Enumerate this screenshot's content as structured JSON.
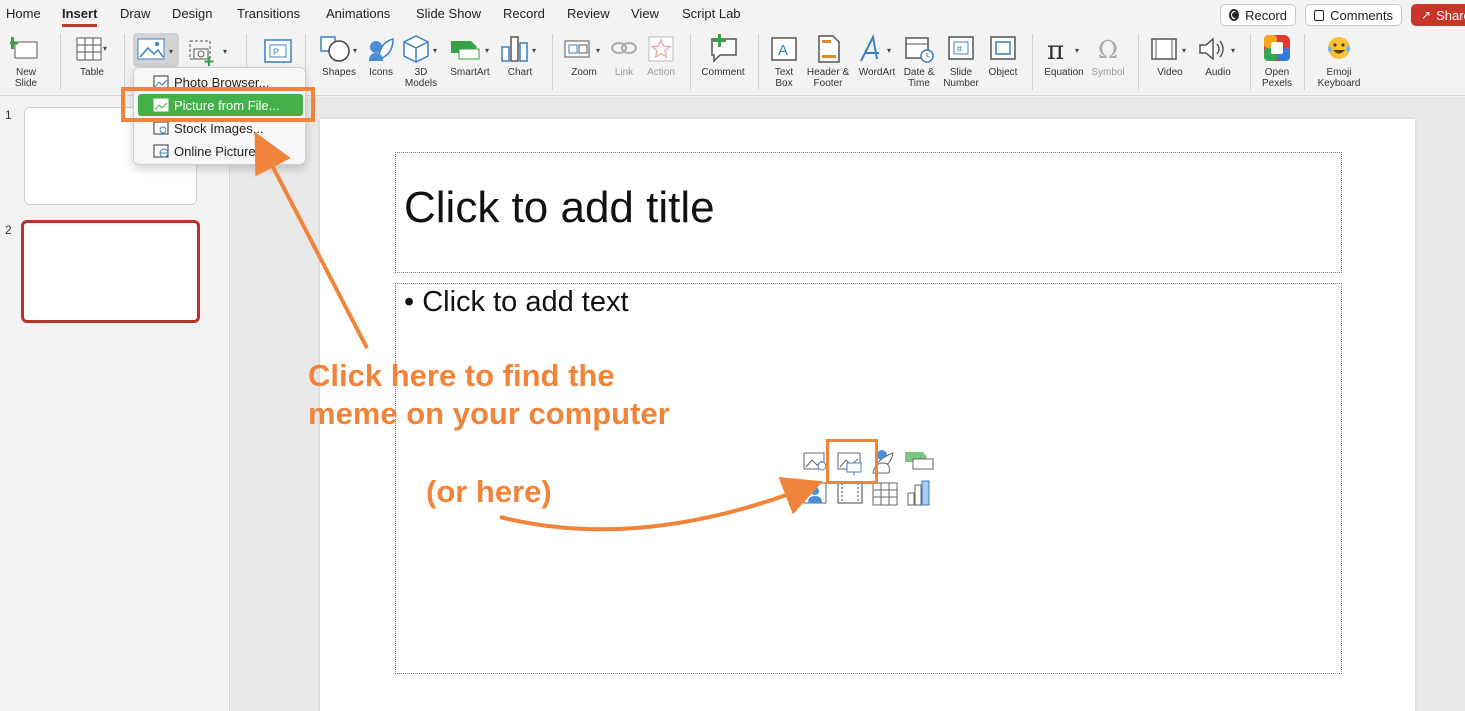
{
  "tabs": [
    "Home",
    "Insert",
    "Draw",
    "Design",
    "Transitions",
    "Animations",
    "Slide Show",
    "Record",
    "Review",
    "View",
    "Script Lab"
  ],
  "active_tab": "Insert",
  "top_right": {
    "record": "Record",
    "comments": "Comments",
    "share": "Share"
  },
  "ribbon": {
    "new_slide": [
      "New",
      "Slide"
    ],
    "table": "Table",
    "shapes": "Shapes",
    "icons": "Icons",
    "models": [
      "3D",
      "Models"
    ],
    "smartart": "SmartArt",
    "chart": "Chart",
    "zoom": "Zoom",
    "link": "Link",
    "action": "Action",
    "comment": "Comment",
    "textbox": [
      "Text",
      "Box"
    ],
    "header_footer": [
      "Header &",
      "Footer"
    ],
    "wordart": "WordArt",
    "date_time": [
      "Date &",
      "Time"
    ],
    "slide_number": [
      "Slide",
      "Number"
    ],
    "object": "Object",
    "equation": "Equation",
    "symbol": "Symbol",
    "video": "Video",
    "audio": "Audio",
    "open_pexels": [
      "Open",
      "Pexels"
    ],
    "emoji_keyboard": [
      "Emoji",
      "Keyboard"
    ]
  },
  "picture_menu": {
    "items": [
      "Photo Browser...",
      "Picture from File...",
      "Stock Images...",
      "Online Pictures..."
    ],
    "highlighted": "Picture from File..."
  },
  "slides": {
    "numbers": [
      "1",
      "2"
    ],
    "selected": "2"
  },
  "slide": {
    "title_placeholder": "Click to add title",
    "body_placeholder": "Click to add text"
  },
  "annotations": {
    "main_line1": "Click here to find the",
    "main_line2": "meme on your computer",
    "secondary": "(or here)",
    "color": "#f0843a"
  },
  "colors": {
    "accent": "#c23b2a",
    "highlight": "#44b049",
    "annotation": "#f0843a"
  }
}
